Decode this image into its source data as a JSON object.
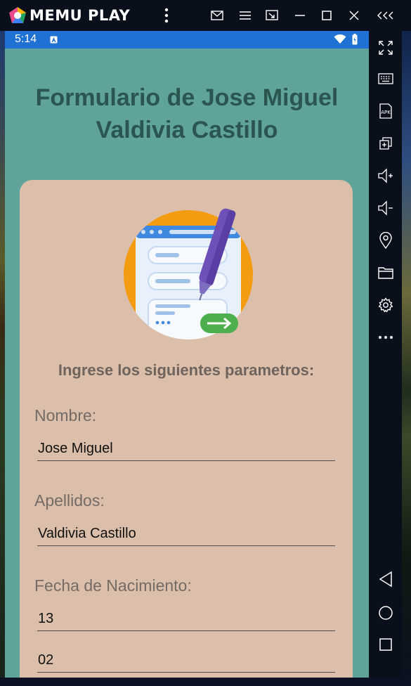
{
  "emulator": {
    "brand": "MEMU PLAY"
  },
  "status_bar": {
    "time": "5:14"
  },
  "app": {
    "title": "Formulario de Jose Miguel Valdivia Castillo",
    "subtitle": "Ingrese los siguientes parametros:",
    "fields": {
      "nombre": {
        "label": "Nombre:",
        "value": "Jose Miguel"
      },
      "apellidos": {
        "label": "Apellidos:",
        "value": "Valdivia Castillo"
      },
      "fecha": {
        "label": "Fecha de Nacimiento:",
        "day": "13",
        "month": "02"
      }
    }
  },
  "colors": {
    "app_background": "#5fa39b",
    "card": "#dcbfaa",
    "status_bar": "#1f72d3",
    "title_text": "#2a5550"
  },
  "icons": {
    "sidebar": [
      "fullscreen-icon",
      "keyboard-icon",
      "apk-icon",
      "multi-window-icon",
      "volume-up-icon",
      "volume-down-icon",
      "location-icon",
      "folder-icon",
      "settings-icon",
      "more-icon",
      "back-icon",
      "home-icon",
      "recents-icon"
    ],
    "titlebar": [
      "menu-dots-icon",
      "mail-icon",
      "hamburger-icon",
      "screen-cast-icon",
      "minimize-icon",
      "maximize-icon",
      "close-icon",
      "collapse-sidebar-icon"
    ]
  }
}
